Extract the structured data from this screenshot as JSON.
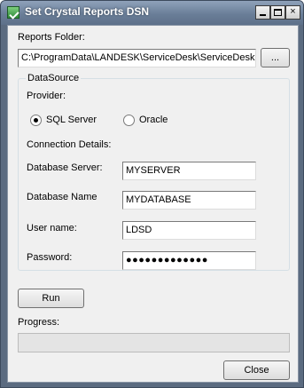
{
  "window": {
    "title": "Set Crystal Reports DSN",
    "controls": {
      "minimize": "minimize",
      "maximize": "maximize",
      "close": "×"
    }
  },
  "reports_folder": {
    "label": "Reports Folder:",
    "value": "C:\\ProgramData\\LANDESK\\ServiceDesk\\ServiceDesk",
    "browse_label": "..."
  },
  "datasource": {
    "group_title": "DataSource",
    "provider_label": "Provider:",
    "providers": [
      {
        "label": "SQL Server",
        "checked": true
      },
      {
        "label": "Oracle",
        "checked": false
      }
    ],
    "connection_details_label": "Connection Details:",
    "fields": {
      "server": {
        "label": "Database Server:",
        "value": "MYSERVER"
      },
      "database": {
        "label": "Database Name",
        "value": "MYDATABASE"
      },
      "username": {
        "label": "User name:",
        "value": "LDSD"
      },
      "password": {
        "label": "Password:",
        "value": "●●●●●●●●●●●●●"
      }
    }
  },
  "run_label": "Run",
  "progress": {
    "label": "Progress:",
    "value": 0
  },
  "close_label": "Close"
}
